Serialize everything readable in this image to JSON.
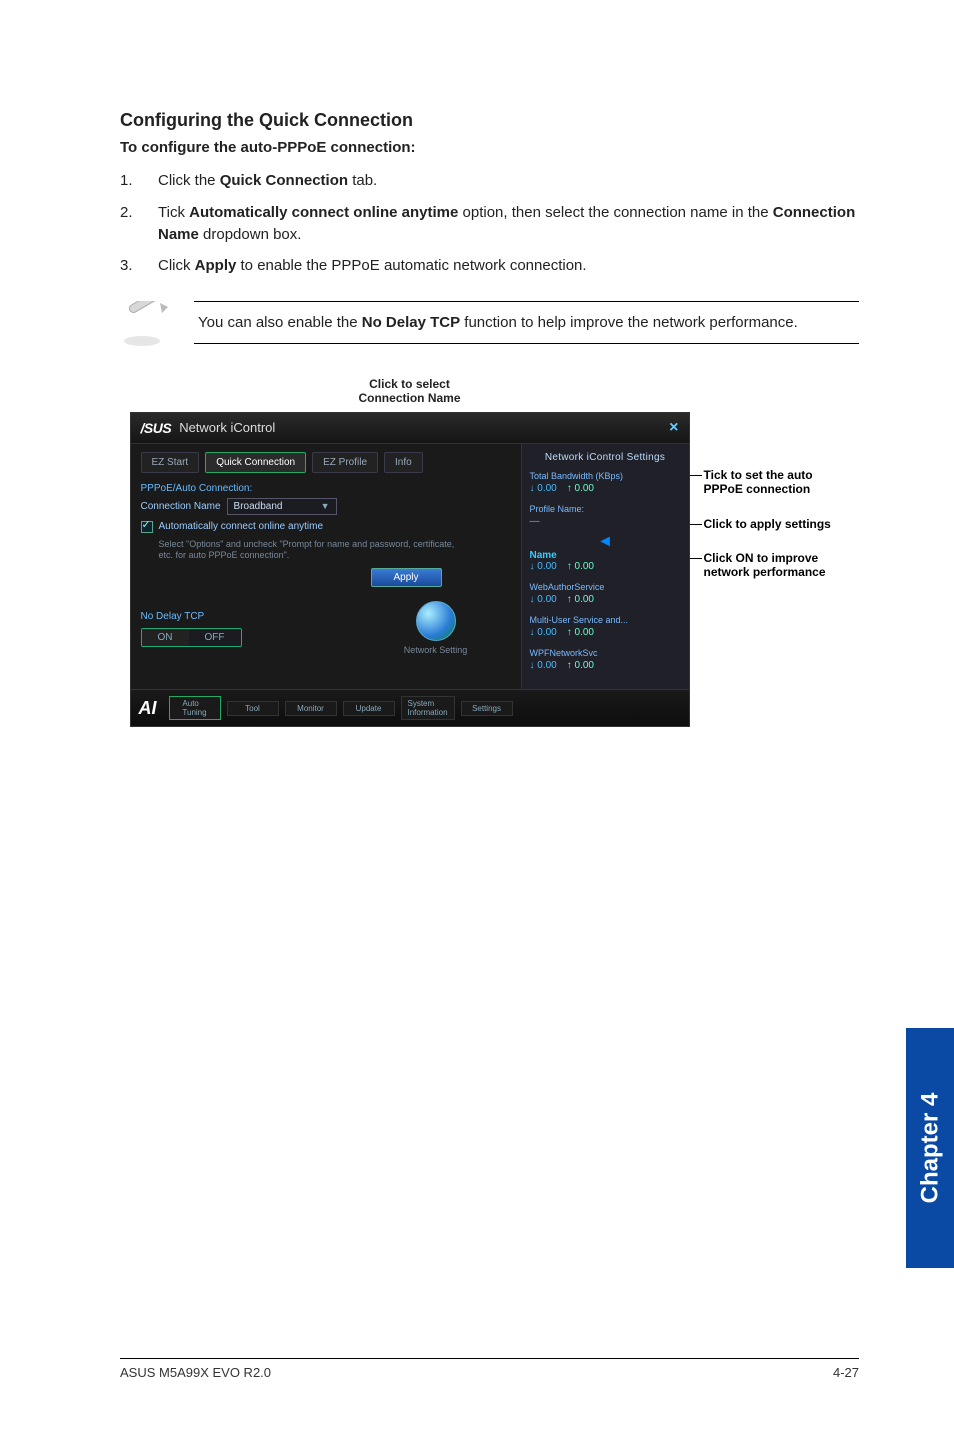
{
  "heading": "Configuring the Quick Connection",
  "subheading": "To configure the auto-PPPoE connection:",
  "steps": [
    {
      "num": "1.",
      "pre": "Click the ",
      "bold1": "Quick Connection",
      "post1": " tab."
    },
    {
      "num": "2.",
      "pre": "Tick ",
      "bold1": "Automatically connect online anytime",
      "mid": " option, then select the connection name in the ",
      "bold2": "Connection Name",
      "post2": " dropdown box."
    },
    {
      "num": "3.",
      "pre": "Click ",
      "bold1": "Apply",
      "post1": " to enable the PPPoE automatic network connection."
    }
  ],
  "note": {
    "pre": "You can also enable the ",
    "bold": "No Delay TCP",
    "post": " function to help improve the network performance."
  },
  "top_label": {
    "l1": "Click to select",
    "l2": "Connection Name"
  },
  "app": {
    "brand": "/SUS",
    "title": "Network iControl",
    "close": "×",
    "tabs": {
      "ez_start": "EZ Start",
      "quick": "Quick Connection",
      "ez_profile": "EZ Profile",
      "info": "Info"
    },
    "left": {
      "section": "PPPoE/Auto Connection:",
      "conn_name_label": "Connection Name",
      "conn_name_value": "Broadband",
      "auto_label": "Automatically connect online anytime",
      "hint": "Select \"Options\" and uncheck \"Prompt for name and password, certificate, etc. for auto PPPoE connection\".",
      "apply": "Apply",
      "nodelay_label": "No Delay TCP",
      "toggle_on": "ON",
      "toggle_off": "OFF",
      "net_icon_caption": "Network Setting"
    },
    "right": {
      "title": "Network iControl Settings",
      "total_bw_label": "Total Bandwidth (KBps)",
      "total_bw_down": "↓ 0.00",
      "total_bw_up": "↑ 0.00",
      "profile_label": "Profile Name:",
      "profile_value": "—",
      "svc1": {
        "name": "Name",
        "down": "↓ 0.00",
        "up": "↑ 0.00"
      },
      "svc2": {
        "name": "WebAuthorService",
        "down": "↓ 0.00",
        "up": "↑ 0.00"
      },
      "svc3": {
        "name": "Multi-User Service and...",
        "down": "↓ 0.00",
        "up": "↑ 0.00"
      },
      "svc4": {
        "name": "WPFNetworkSvc",
        "down": "↓ 0.00",
        "up": "↑ 0.00"
      }
    },
    "bottom": {
      "logo": "AI",
      "auto_tuning": "Auto\nTuning",
      "tool": "Tool",
      "monitor": "Monitor",
      "update": "Update",
      "sysinfo": "System\nInformation",
      "settings": "Settings"
    }
  },
  "callouts": {
    "c1": "Tick to set the auto PPPoE connection",
    "c2": "Click to apply settings",
    "c3": "Click ON to improve network performance"
  },
  "chapter_tab": "Chapter 4",
  "footer": {
    "left": "ASUS M5A99X EVO R2.0",
    "right": "4-27"
  }
}
